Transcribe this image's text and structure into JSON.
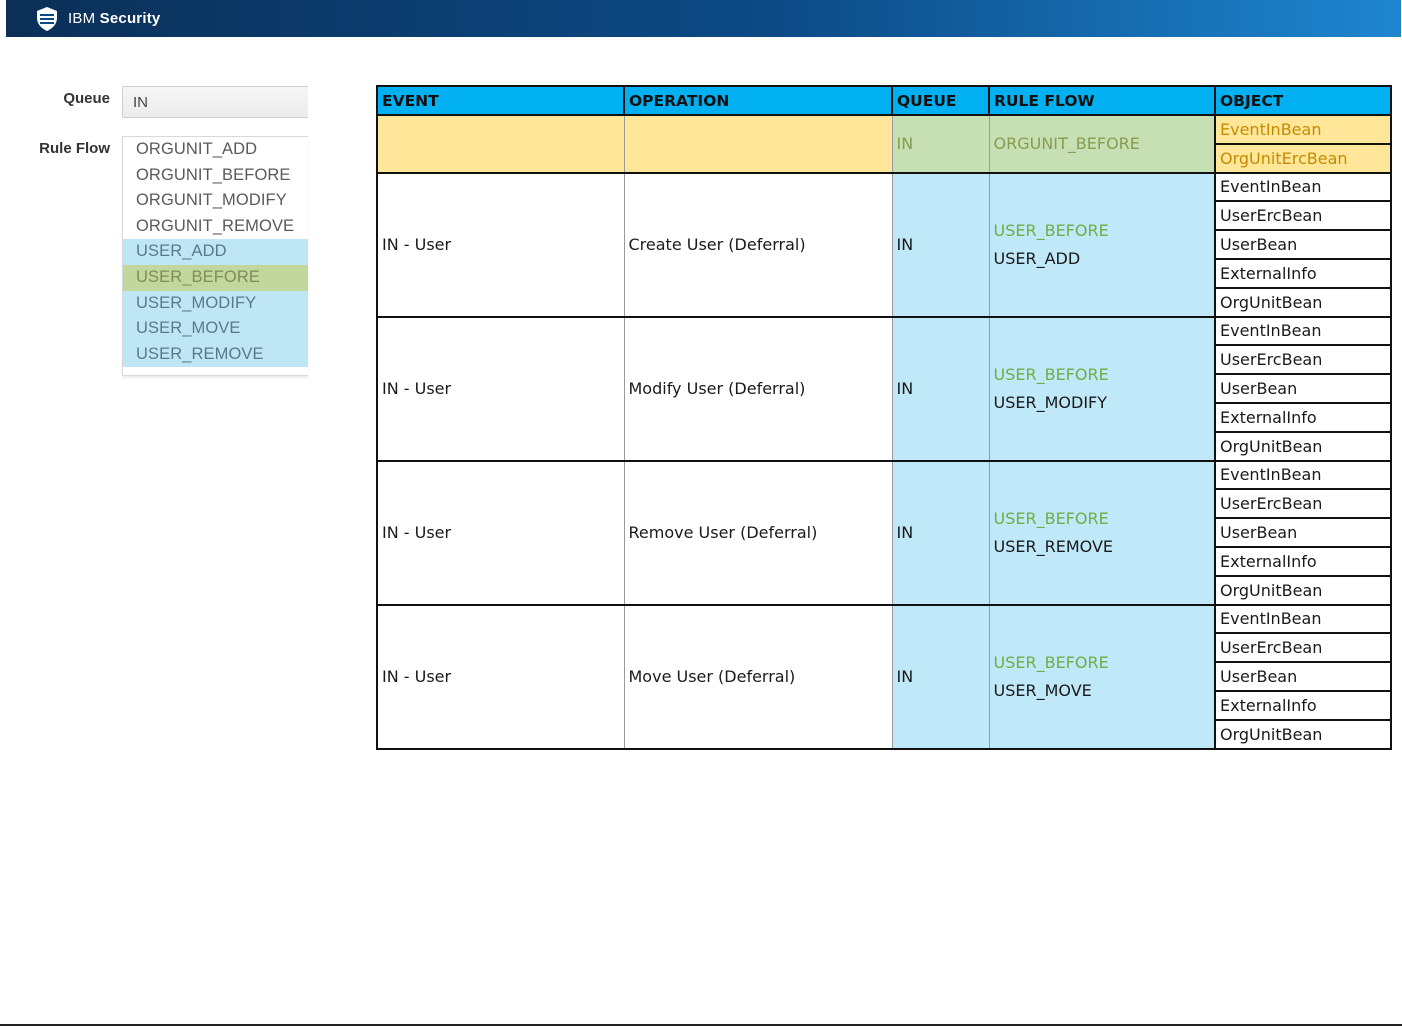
{
  "header": {
    "brand_ibm": "IBM",
    "brand_security": "Security",
    "brand_icon": "ibm-security-logo-icon",
    "bar_color": "#0c4a86"
  },
  "form": {
    "queue_label": "Queue",
    "queue_value": "IN",
    "ruleflow_label": "Rule Flow",
    "ruleflow_options": [
      {
        "label": "ORGUNIT_ADD",
        "state": "normal"
      },
      {
        "label": "ORGUNIT_BEFORE",
        "state": "normal"
      },
      {
        "label": "ORGUNIT_MODIFY",
        "state": "normal"
      },
      {
        "label": "ORGUNIT_REMOVE",
        "state": "normal"
      },
      {
        "label": "USER_ADD",
        "state": "selected"
      },
      {
        "label": "USER_BEFORE",
        "state": "highlight"
      },
      {
        "label": "USER_MODIFY",
        "state": "selected"
      },
      {
        "label": "USER_MOVE",
        "state": "selected"
      },
      {
        "label": "USER_REMOVE",
        "state": "selected"
      }
    ]
  },
  "table": {
    "headers": [
      "EVENT",
      "OPERATION",
      "QUEUE",
      "RULE FLOW",
      "OBJECT"
    ],
    "header_color": "#00b0f0",
    "top_row": {
      "event": "",
      "operation": "",
      "queue": "IN",
      "rule_flow": "ORGUNIT_BEFORE",
      "objects": [
        "EventInBean",
        "OrgUnitErcBean"
      ]
    },
    "rows": [
      {
        "event": "IN - User",
        "operation": "Create User (Deferral)",
        "queue": "IN",
        "rule_flow_before": "USER_BEFORE",
        "rule_flow": "USER_ADD",
        "objects": [
          "EventInBean",
          "UserErcBean",
          "UserBean",
          "ExternalInfo",
          "OrgUnitBean"
        ]
      },
      {
        "event": "IN - User",
        "operation": "Modify User (Deferral)",
        "queue": "IN",
        "rule_flow_before": "USER_BEFORE",
        "rule_flow": "USER_MODIFY",
        "objects": [
          "EventInBean",
          "UserErcBean",
          "UserBean",
          "ExternalInfo",
          "OrgUnitBean"
        ]
      },
      {
        "event": "IN - User",
        "operation": "Remove User (Deferral)",
        "queue": "IN",
        "rule_flow_before": "USER_BEFORE",
        "rule_flow": "USER_REMOVE",
        "objects": [
          "EventInBean",
          "UserErcBean",
          "UserBean",
          "ExternalInfo",
          "OrgUnitBean"
        ]
      },
      {
        "event": "IN - User",
        "operation": "Move User (Deferral)",
        "queue": "IN",
        "rule_flow_before": "USER_BEFORE",
        "rule_flow": "USER_MOVE",
        "objects": [
          "EventInBean",
          "UserErcBean",
          "UserBean",
          "ExternalInfo",
          "OrgUnitBean"
        ]
      }
    ]
  }
}
